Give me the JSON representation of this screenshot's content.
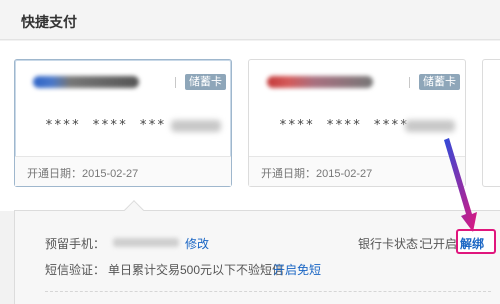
{
  "section": {
    "title": "快捷支付"
  },
  "cards": [
    {
      "type_badge": "储蓄卡",
      "number_mask": "**** **** ***",
      "open_date": "开通日期：2015-02-27",
      "selected": true
    },
    {
      "type_badge": "储蓄卡",
      "number_mask": "**** **** ****",
      "open_date": "开通日期：2015-02-27",
      "selected": false
    }
  ],
  "detail": {
    "phone_label": "预留手机：",
    "modify_link": "修改",
    "card_status_label": "银行卡状态：",
    "card_status_value": "已开启",
    "unbind_link": "解绑",
    "sms_label": "短信验证：",
    "sms_desc": "单日累计交易500元以下不验短信",
    "enable_free_link": "开启免短"
  },
  "annotation": {
    "arrow_color": "#e0167d",
    "arrow_color_start": "#2f4bd9"
  }
}
